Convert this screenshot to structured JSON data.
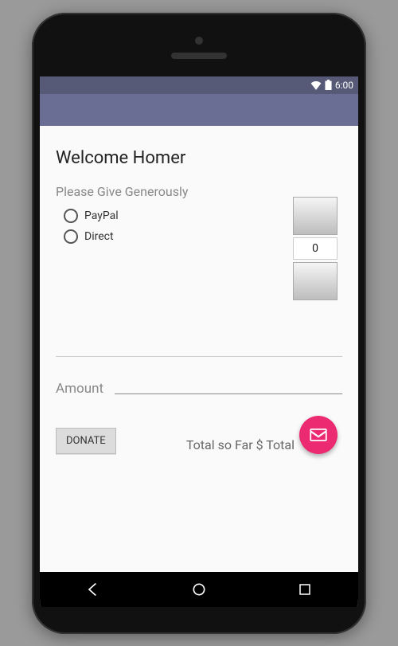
{
  "status": {
    "time": "6:00"
  },
  "title": "Welcome Homer",
  "section": {
    "label": "Please Give Generously",
    "options": [
      "PayPal",
      "Direct"
    ]
  },
  "picker": {
    "value": "0"
  },
  "amount_label": "Amount",
  "donate_label": "DONATE",
  "total_prefix": "Total so Far  $ ",
  "total_value": "Total"
}
